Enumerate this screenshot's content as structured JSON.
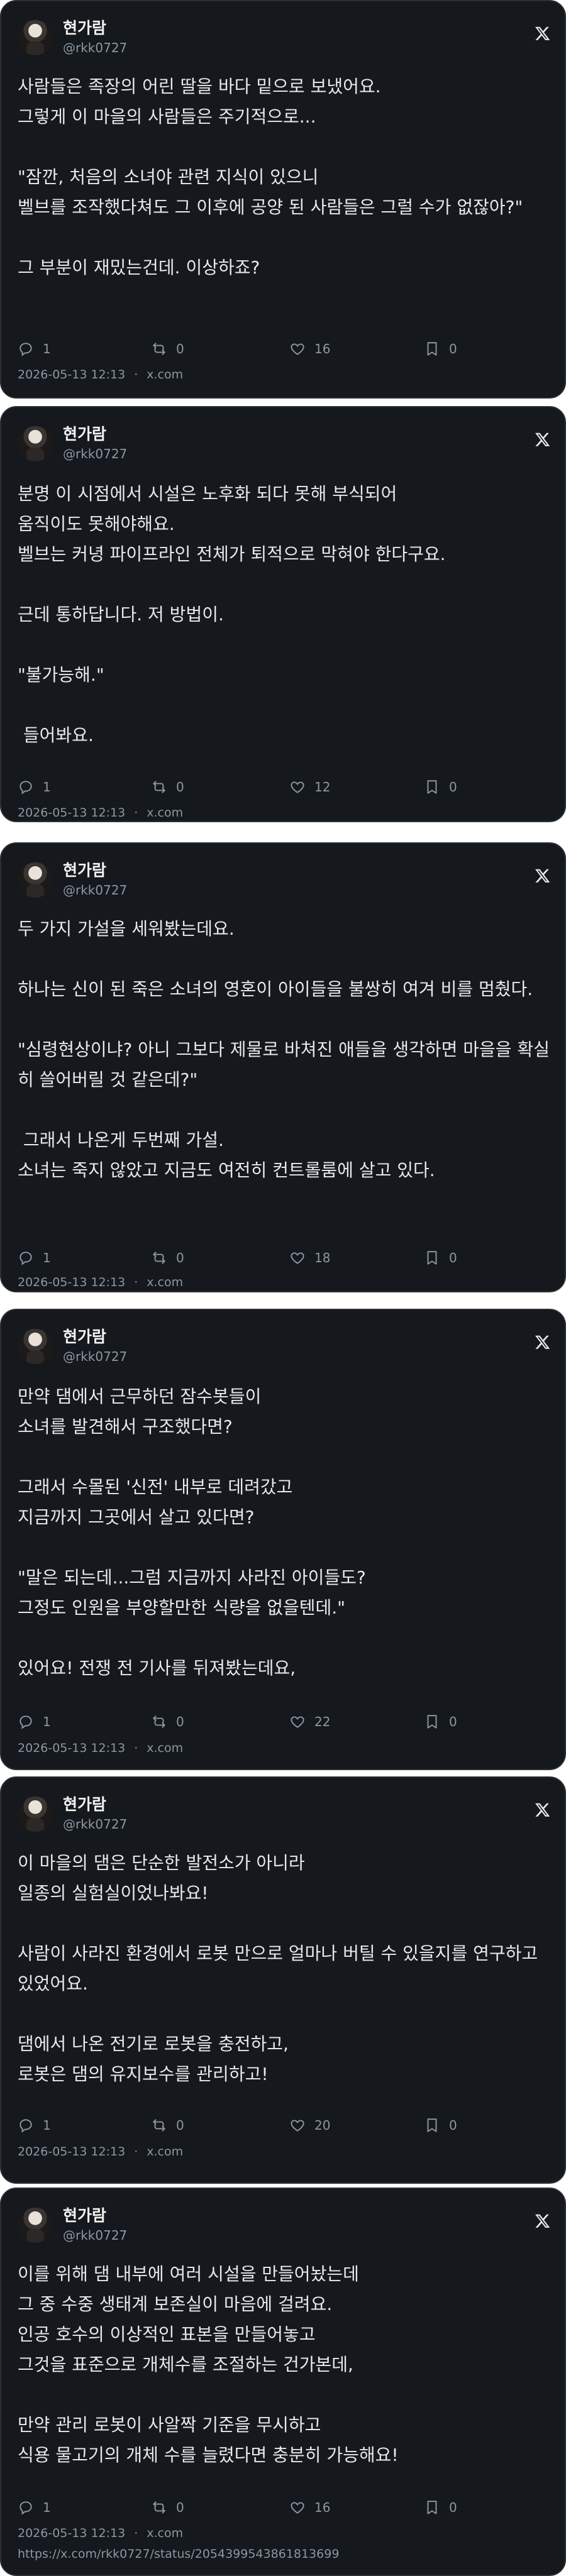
{
  "source_label": "x.com",
  "tweets": [
    {
      "display_name": "현가람",
      "handle": "@rkk0727",
      "text": "사람들은 족장의 어린 딸을 바다 밑으로 보냈어요.\n그렇게 이 마을의 사람들은 주기적으로...\n\n\"잠깐, 처음의 소녀야 관련 지식이 있으니\n벨브를 조작했다쳐도 그 이후에 공양 된 사람들은 그럴 수가 없잖아?\"\n\n그 부분이 재밌는건데. 이상하죠?",
      "replies": "1",
      "reposts": "0",
      "likes": "16",
      "bookmarks": "0",
      "timestamp": "2026-05-13 12:13",
      "source": "x.com"
    },
    {
      "display_name": "현가람",
      "handle": "@rkk0727",
      "text": "분명 이 시점에서 시설은 노후화 되다 못해 부식되어\n움직이도 못해야해요.\n벨브는 커녕 파이프라인 전체가 퇴적으로 막혀야 한다구요.\n\n근데 통하답니다. 저 방법이.\n\n\"불가능해.\"\n\n 들어봐요.",
      "replies": "1",
      "reposts": "0",
      "likes": "12",
      "bookmarks": "0",
      "timestamp": "2026-05-13 12:13",
      "source": "x.com"
    },
    {
      "display_name": "현가람",
      "handle": "@rkk0727",
      "text": "두 가지 가설을 세워봤는데요.\n\n하나는 신이 된 죽은 소녀의 영혼이 아이들을 불쌍히 여겨 비를 멈췄다.\n\n\"심령현상이냐? 아니 그보다 제물로 바쳐진 애들을 생각하면 마을을 확실히 쓸어버릴 것 같은데?\"\n\n 그래서 나온게 두번째 가설.\n소녀는 죽지 않았고 지금도 여전히 컨트롤룸에 살고 있다.",
      "replies": "1",
      "reposts": "0",
      "likes": "18",
      "bookmarks": "0",
      "timestamp": "2026-05-13 12:13",
      "source": "x.com"
    },
    {
      "display_name": "현가람",
      "handle": "@rkk0727",
      "text": "만약 댐에서 근무하던 잠수봇들이\n소녀를 발견해서 구조했다면?\n\n그래서 수몰된 '신전' 내부로 데려갔고\n지금까지 그곳에서 살고 있다면?\n\n\"말은 되는데...그럼 지금까지 사라진 아이들도?\n그정도 인원을 부양할만한 식량을 없을텐데.\"\n\n있어요! 전쟁 전 기사를 뒤져봤는데요,",
      "replies": "1",
      "reposts": "0",
      "likes": "22",
      "bookmarks": "0",
      "timestamp": "2026-05-13 12:13",
      "source": "x.com"
    },
    {
      "display_name": "현가람",
      "handle": "@rkk0727",
      "text": "이 마을의 댐은 단순한 발전소가 아니라\n일종의 실험실이었나봐요!\n\n사람이 사라진 환경에서 로봇 만으로 얼마나 버틸 수 있을지를 연구하고 있었어요.\n\n댐에서 나온 전기로 로봇을 충전하고,\n로봇은 댐의 유지보수를 관리하고!",
      "replies": "1",
      "reposts": "0",
      "likes": "20",
      "bookmarks": "0",
      "timestamp": "2026-05-13 12:13",
      "source": "x.com"
    },
    {
      "display_name": "현가람",
      "handle": "@rkk0727",
      "text": "이를 위해 댐 내부에 여러 시설을 만들어놨는데\n그 중 수중 생태계 보존실이 마음에 걸려요.\n인공 호수의 이상적인 표본을 만들어놓고\n그것을 표준으로 개체수를 조절하는 건가본데,\n\n만약 관리 로봇이 사알짝 기준을 무시하고\n식용 물고기의 개체 수를 늘렸다면 충분히 가능해요!",
      "replies": "1",
      "reposts": "0",
      "likes": "16",
      "bookmarks": "0",
      "timestamp": "2026-05-13 12:13",
      "source": "x.com",
      "permalink": "https://x.com/rkk0727/status/2054399543861813699"
    }
  ]
}
